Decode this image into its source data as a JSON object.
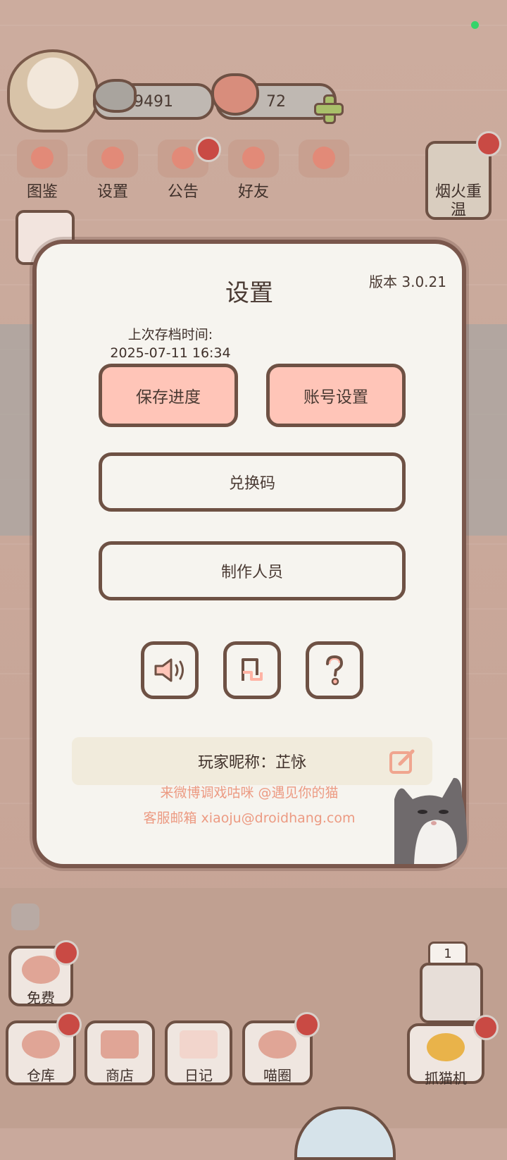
{
  "hud": {
    "fish_count": "9491",
    "heart_count": "72"
  },
  "menu": [
    {
      "label": "图鉴"
    },
    {
      "label": "设置"
    },
    {
      "label": "公告"
    },
    {
      "label": "好友"
    }
  ],
  "side_event": {
    "label": "烟火重温"
  },
  "dialog": {
    "title": "设置",
    "version": "版本 3.0.21",
    "save_time_label": "上次存档时间:",
    "save_time_value": "2025-07-11 16:34",
    "save_button": "保存进度",
    "account_button": "账号设置",
    "redeem_button": "兑换码",
    "credits_button": "制作人员",
    "icons": [
      "sound-icon",
      "music-icon",
      "help-icon"
    ],
    "nickname": "玩家昵称：芷怺",
    "footer_weibo": "来微博调戏咕咪 @遇见你的猫",
    "footer_email": "客服邮箱 xiaoju@droidhang.com"
  },
  "bottom_nav": {
    "free": "免费",
    "warehouse": "仓库",
    "shop": "商店",
    "diary": "日记",
    "circle": "喵圈",
    "claw_machine": "抓猫机",
    "claw_count": "1"
  },
  "colors": {
    "dialog_bg": "#f6f4ef",
    "border": "#6e5144",
    "pink_button": "#ffc5b8",
    "footer_text": "#ec9a82",
    "badge": "#c94a44"
  }
}
